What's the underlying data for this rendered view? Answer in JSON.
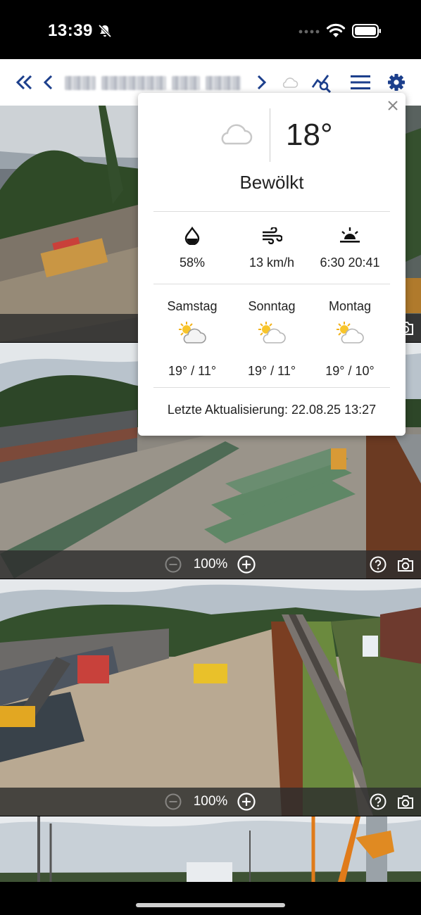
{
  "status_bar": {
    "time": "13:39"
  },
  "toolbar": {
    "camera_name": "░░░ ░░░░░░ ░░░░░░░",
    "accent_color": "#1c3f8c"
  },
  "feeds": [
    {
      "zoom": "100%"
    },
    {
      "zoom": "100%"
    }
  ],
  "weather": {
    "current_temp": "18°",
    "condition": "Bewölkt",
    "humidity": "58%",
    "wind": "13 km/h",
    "sun": "6:30 20:41",
    "forecast": [
      {
        "day": "Samstag",
        "temps": "19° / 11°",
        "icon": "partly-cloudy-icon"
      },
      {
        "day": "Sonntag",
        "temps": "19° / 11°",
        "icon": "partly-cloudy-icon"
      },
      {
        "day": "Montag",
        "temps": "19° / 10°",
        "icon": "partly-cloudy-icon"
      }
    ],
    "last_update": "Letzte Aktualisierung: 22.08.25 13:27"
  }
}
